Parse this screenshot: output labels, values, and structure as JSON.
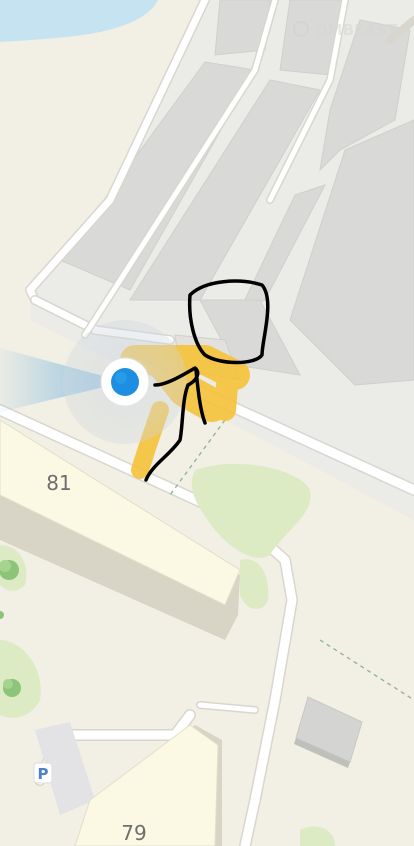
{
  "map": {
    "watermark": "OMBEAST",
    "building_labels": [
      "81",
      "79"
    ],
    "parking_label": "P",
    "icons": [
      "user-location-icon",
      "parking-icon",
      "tree-icon"
    ],
    "colors": {
      "land": "#f2efe4",
      "water": "#c6e3f2",
      "road": "#ffffff",
      "road_edge": "#d8d6cf",
      "block_area": "#e9e9e7",
      "building_roof": "#dadad8",
      "residential_building": "#fbf8e3",
      "park": "#dcebc4",
      "tree": "#8cc47a",
      "location_dot": "#1e8fe0",
      "highlight": "#f5c23a",
      "drawing": "#000000"
    }
  }
}
